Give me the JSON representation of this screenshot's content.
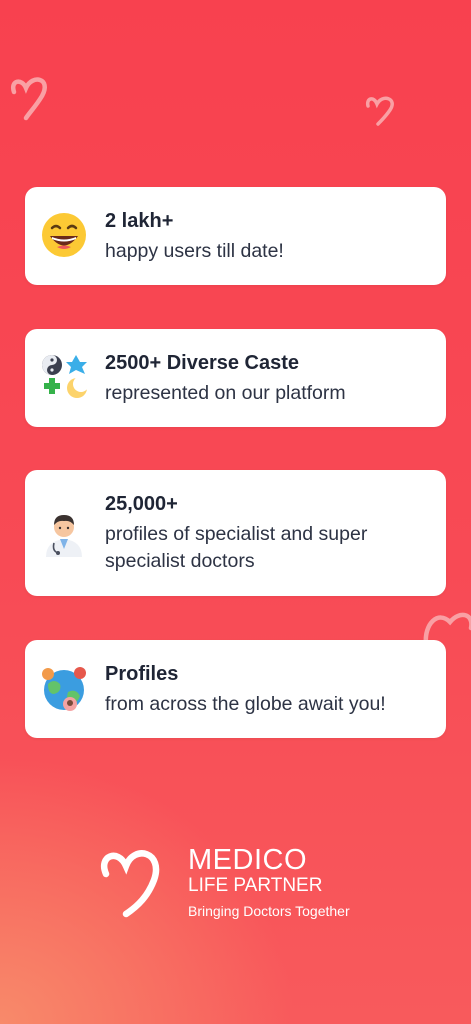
{
  "cards": [
    {
      "title": "2 lakh+",
      "subtitle": "happy users till date!",
      "icon": "grinning-face-icon"
    },
    {
      "title": "2500+ Diverse Caste",
      "subtitle": "represented on our platform",
      "icon": "religion-symbols-icon"
    },
    {
      "title": "25,000+",
      "subtitle": "profiles of specialist and super specialist doctors",
      "icon": "doctor-icon"
    },
    {
      "title": "Profiles",
      "subtitle": "from across the globe await you!",
      "icon": "globe-people-icon"
    }
  ],
  "brand": {
    "name": "MEDICO",
    "subname": "LIFE PARTNER",
    "tagline": "Bringing Doctors Together"
  },
  "colors": {
    "background": "#f8414f",
    "card": "#ffffff",
    "text": "#1f2535"
  }
}
